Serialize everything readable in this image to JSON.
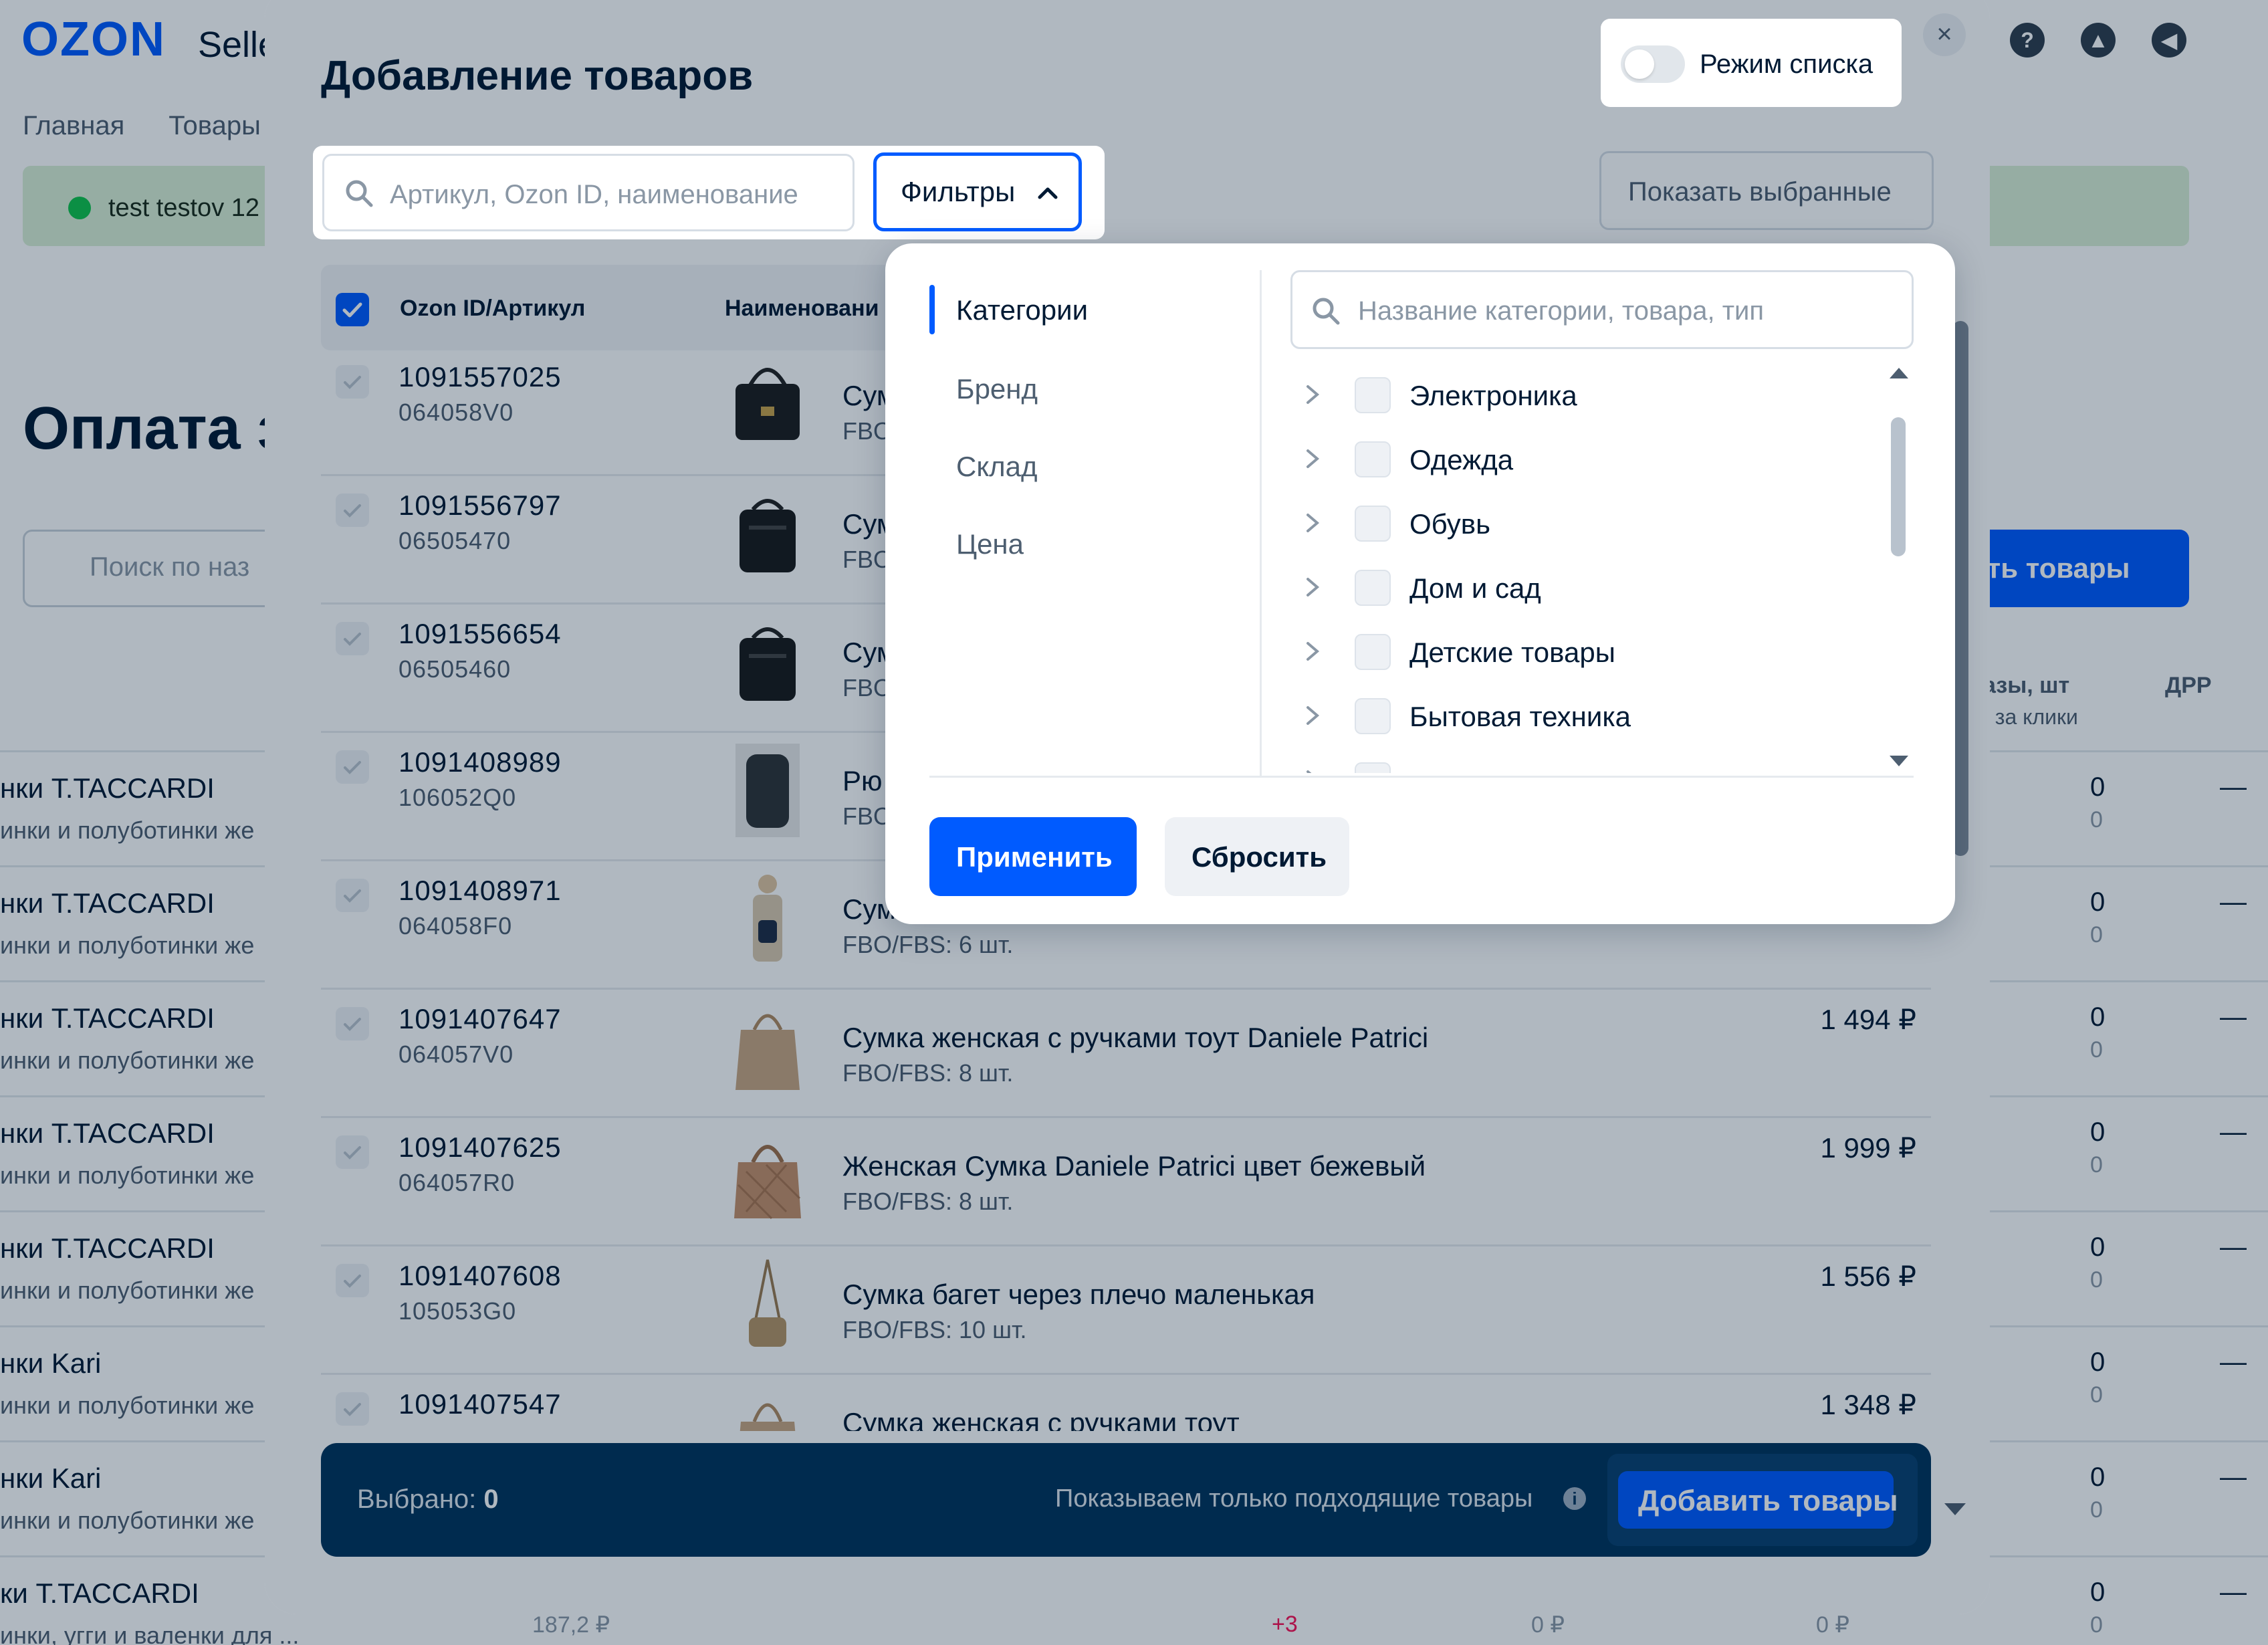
{
  "background": {
    "logo": "OZON",
    "logo_suffix": "Selle",
    "nav": [
      "Главная",
      "Товары"
    ],
    "banner_text": "test testov 12",
    "page_title": "Оплата з",
    "search_placeholder": "Поиск по наз",
    "add_button": "вить товары",
    "col_orders_head": "азы, шт",
    "col_orders_sub": ", за клики",
    "col_drr_head": "ДРР",
    "rows": [
      {
        "title": "нки T.TACCARDI",
        "sub": "инки и полуботинки же",
        "v1": "0",
        "v2": "0",
        "dash": "—"
      },
      {
        "title": "нки T.TACCARDI",
        "sub": "инки и полуботинки же",
        "v1": "0",
        "v2": "0",
        "dash": "—"
      },
      {
        "title": "нки T.TACCARDI",
        "sub": "инки и полуботинки же",
        "v1": "0",
        "v2": "0",
        "dash": "—"
      },
      {
        "title": "нки T.TACCARDI",
        "sub": "инки и полуботинки же",
        "v1": "0",
        "v2": "0",
        "dash": "—"
      },
      {
        "title": "нки T.TACCARDI",
        "sub": "инки и полуботинки же",
        "v1": "0",
        "v2": "0",
        "dash": "—"
      },
      {
        "title": "нки Kari",
        "sub": "инки и полуботинки же",
        "v1": "0",
        "v2": "0",
        "dash": "—"
      },
      {
        "title": "нки Kari",
        "sub": "инки и полуботинки же",
        "v1": "0",
        "v2": "0",
        "dash": "—"
      },
      {
        "title": "ки T.TACCARDI",
        "sub": "инки, угги и валенки для ...",
        "v1": "0",
        "v2": "0",
        "dash": "—"
      }
    ],
    "footer": {
      "a": "187,2 ₽",
      "b": "+3",
      "c": "0 ₽",
      "d": "0 ₽"
    }
  },
  "modal": {
    "title": "Добавление товаров",
    "close_glyph": "×",
    "list_mode_label": "Режим списка",
    "search_placeholder": "Артикул, Ozon ID, наименование",
    "filters_label": "Фильтры",
    "show_selected_label": "Показать выбранные",
    "table_headers": {
      "id": "Ozon ID/Артикул",
      "name": "Наименовани"
    },
    "rows": [
      {
        "id": "1091557025",
        "sku": "064058V0",
        "name": "Сум",
        "stock": "FBO",
        "price": ""
      },
      {
        "id": "1091556797",
        "sku": "06505470",
        "name": "Сум",
        "stock": "FBO",
        "price": ""
      },
      {
        "id": "1091556654",
        "sku": "06505460",
        "name": "Сум",
        "stock": "FBO",
        "price": ""
      },
      {
        "id": "1091408989",
        "sku": "106052Q0",
        "name": "Рю",
        "stock": "FBO",
        "price": ""
      },
      {
        "id": "1091408971",
        "sku": "064058F0",
        "name": "Сум",
        "stock": "FBO/FBS: 6 шт.",
        "price": ""
      },
      {
        "id": "1091407647",
        "sku": "064057V0",
        "name": "Сумка женская с ручками тоут Daniele Patrici",
        "stock": "FBO/FBS: 8 шт.",
        "price": "1 494 ₽"
      },
      {
        "id": "1091407625",
        "sku": "064057R0",
        "name": "Женская Сумка Daniele Patrici цвет бежевый",
        "stock": "FBO/FBS: 8 шт.",
        "price": "1 999 ₽"
      },
      {
        "id": "1091407608",
        "sku": "105053G0",
        "name": "Сумка багет через плечо маленькая",
        "stock": "FBO/FBS: 10 шт.",
        "price": "1 556 ₽"
      },
      {
        "id": "1091407547",
        "sku": "",
        "name": "Сумка женская с ручками тоут",
        "stock": "",
        "price": "1 348 ₽"
      }
    ],
    "bottom_bar": {
      "selected_label": "Выбрано:",
      "selected_count": "0",
      "only_matching": "Показываем только подходящие товары",
      "info_glyph": "i",
      "add_button": "Добавить товары"
    }
  },
  "filters_panel": {
    "nav": [
      "Категории",
      "Бренд",
      "Склад",
      "Цена"
    ],
    "active_nav": "Категории",
    "search_placeholder": "Название категории, товара, тип",
    "categories": [
      "Электроника",
      "Одежда",
      "Обувь",
      "Дом и сад",
      "Детские товары",
      "Бытовая техника"
    ],
    "apply_label": "Применить",
    "reset_label": "Сбросить"
  },
  "colors": {
    "accent": "#005bff",
    "bottom_bar": "#00335c",
    "overlay": "rgba(0,26,52,0.31)"
  }
}
